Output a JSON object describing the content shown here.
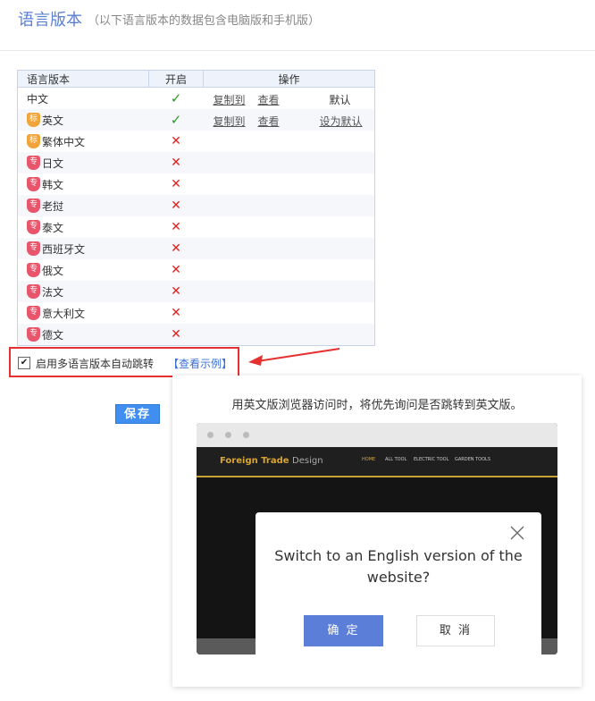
{
  "header": {
    "title": "语言版本",
    "subtitle": "（以下语言版本的数据包含电脑版和手机版）"
  },
  "table": {
    "headers": [
      "语言版本",
      "开启",
      "操作"
    ],
    "rows": [
      {
        "name": "中文",
        "badge": "",
        "enabled": true,
        "copy": "复制到",
        "view": "查看",
        "action": "默认",
        "action_is_link": false
      },
      {
        "name": "英文",
        "badge": "标",
        "enabled": true,
        "copy": "复制到",
        "view": "查看",
        "action": "设为默认",
        "action_is_link": true
      },
      {
        "name": "繁体中文",
        "badge": "标",
        "enabled": false
      },
      {
        "name": "日文",
        "badge": "专",
        "enabled": false
      },
      {
        "name": "韩文",
        "badge": "专",
        "enabled": false
      },
      {
        "name": "老挝",
        "badge": "专",
        "enabled": false
      },
      {
        "name": "泰文",
        "badge": "专",
        "enabled": false
      },
      {
        "name": "西班牙文",
        "badge": "专",
        "enabled": false
      },
      {
        "name": "俄文",
        "badge": "专",
        "enabled": false
      },
      {
        "name": "法文",
        "badge": "专",
        "enabled": false
      },
      {
        "name": "意大利文",
        "badge": "专",
        "enabled": false
      },
      {
        "name": "德文",
        "badge": "专",
        "enabled": false
      }
    ],
    "check_glyph": "✓",
    "cross_glyph": "✕"
  },
  "auto_redirect": {
    "checked": true,
    "label": "启用多语言版本自动跳转",
    "example_link": "【查看示例】"
  },
  "save_button": "保存",
  "preview": {
    "caption": "用英文版浏览器访问时，将优先询问是否跳转到英文版。",
    "site_logo": "Foreign Trade",
    "site_logo_suffix": "Design",
    "nav_items": [
      "HOME",
      "ALL TOOL",
      "ELECTRIC TOOL",
      "GARDEN TOOLS"
    ],
    "modal_text": "Switch to an English version of the website?",
    "ok_button": "确 定",
    "cancel_button": "取 消"
  },
  "colors": {
    "accent": "#5b7fd2",
    "check": "#2a9a2a",
    "cross": "#e02020",
    "highlight_border": "#e53030"
  }
}
